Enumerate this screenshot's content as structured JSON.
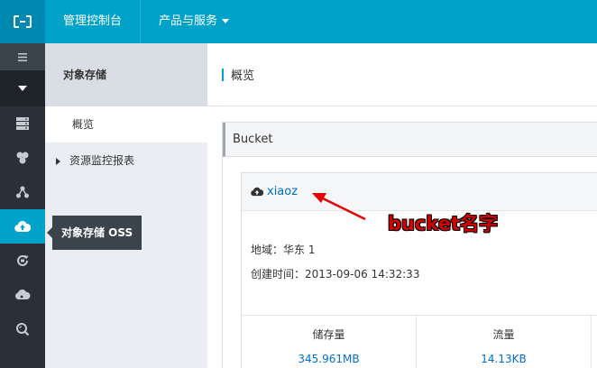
{
  "topbar": {
    "console": "管理控制台",
    "products": "产品与服务"
  },
  "iconnav": {
    "active_tooltip": "对象存储 OSS"
  },
  "subnav": {
    "title": "对象存储",
    "items": [
      {
        "label": "概览"
      },
      {
        "label": "资源监控报表"
      }
    ]
  },
  "main": {
    "title": "概览",
    "panel_title": "Bucket",
    "bucket": {
      "name": "xiaoz",
      "region": "地域：华东 1",
      "created": "创建时间：2013-09-06 14:32:33",
      "stats": [
        {
          "label": "储存量",
          "value": "345.961MB"
        },
        {
          "label": "流量",
          "value": "14.13KB"
        }
      ]
    }
  },
  "annotation": {
    "text": "bucket名字",
    "color": "#d40000"
  },
  "colors": {
    "accent": "#00a2ca",
    "nav_bg": "#293038",
    "link": "#0070cc"
  }
}
